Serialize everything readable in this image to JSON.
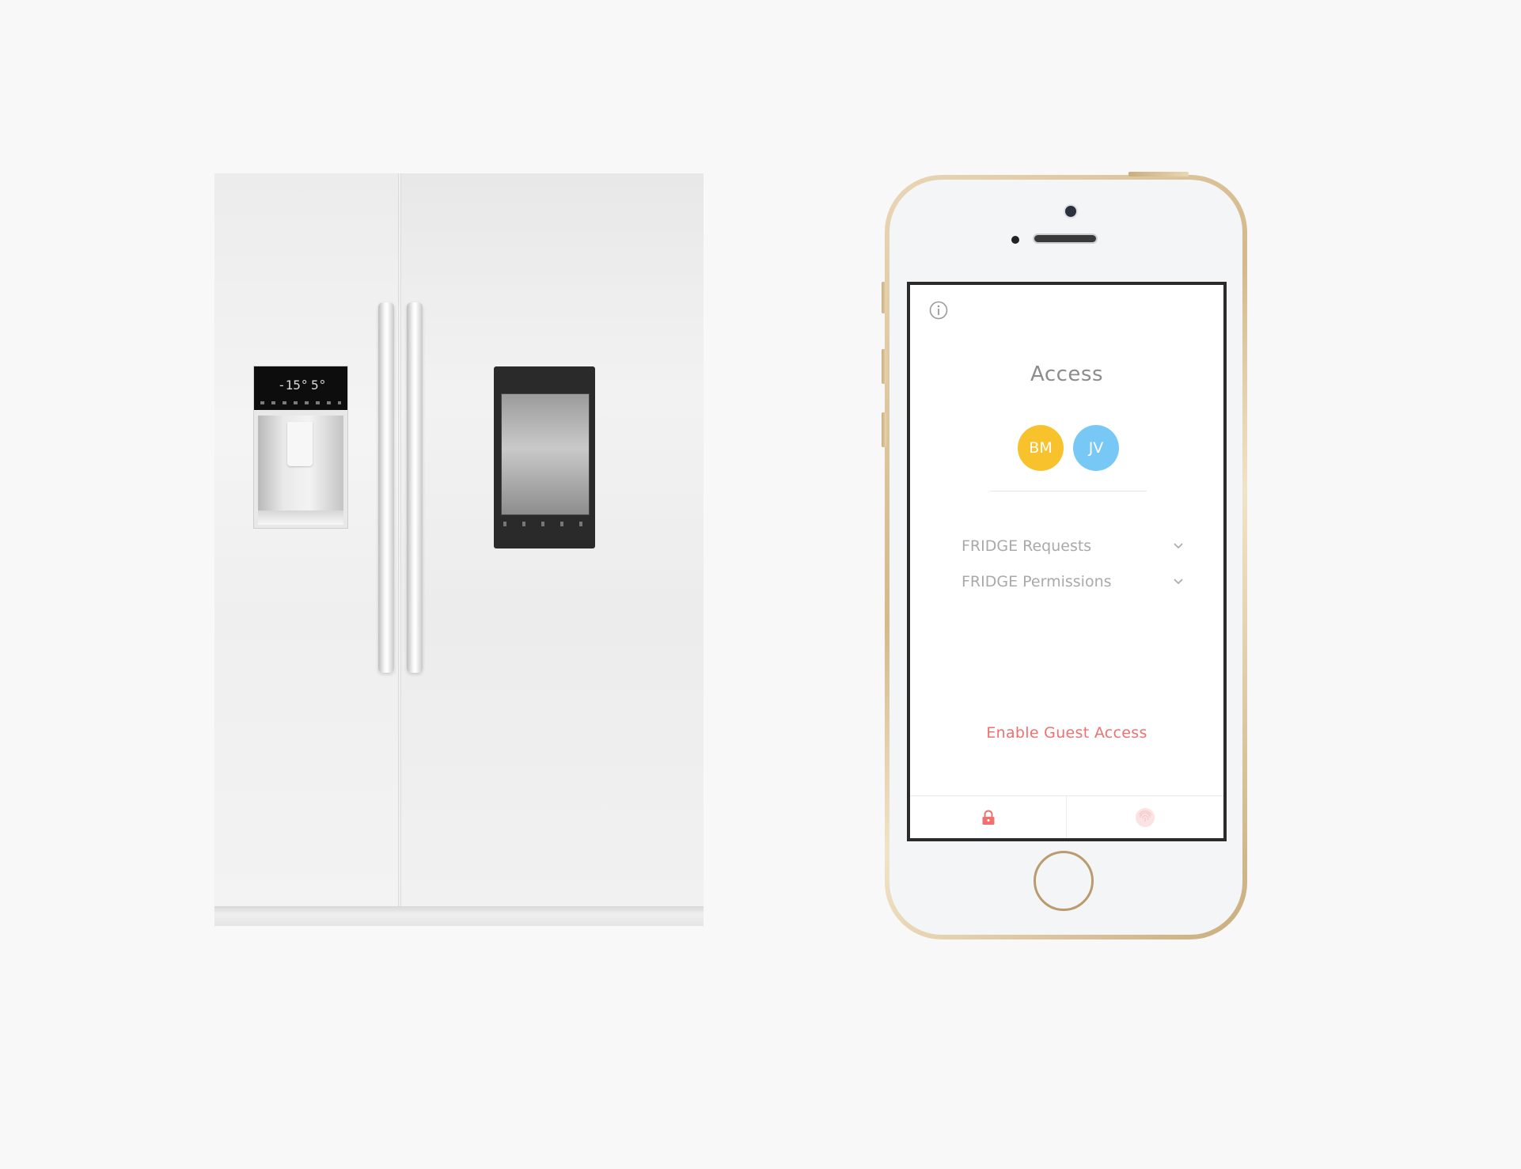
{
  "app": {
    "title": "Access",
    "users": [
      {
        "initials": "BM",
        "color": "#f8c22c"
      },
      {
        "initials": "JV",
        "color": "#78c8f5"
      }
    ],
    "menu": [
      {
        "label": "FRIDGE Requests",
        "icon": "chevron-down-icon"
      },
      {
        "label": "FRIDGE Permissions",
        "icon": "chevron-down-icon"
      }
    ],
    "guest_access_label": "Enable Guest Access",
    "tabs": [
      {
        "icon": "lock-icon",
        "active": true,
        "color": "#f07070"
      },
      {
        "icon": "fingerprint-icon",
        "active": false,
        "color": "#f5c9c9"
      }
    ],
    "info_icon": "info-icon"
  },
  "fridge": {
    "display_left": "-15°",
    "display_right": "5°"
  },
  "colors": {
    "accent": "#f07070",
    "title": "#8c8c8c",
    "menu_text": "#a9a9a9",
    "page_bg": "#f8f8f8"
  }
}
